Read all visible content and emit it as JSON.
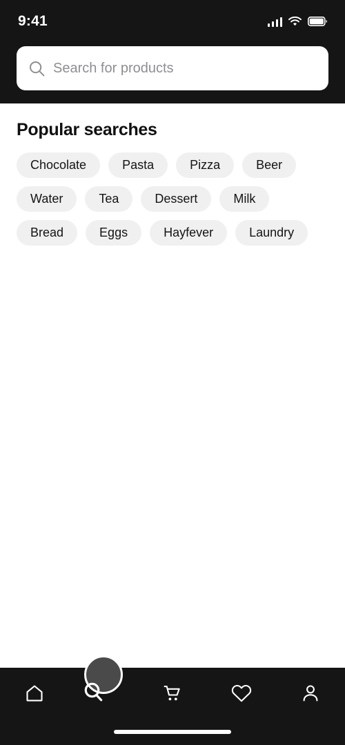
{
  "status_bar": {
    "time": "9:41",
    "icons": [
      "cellular-signal-icon",
      "wifi-icon",
      "battery-icon"
    ]
  },
  "search": {
    "placeholder": "Search for products",
    "value": "",
    "icon": "search-icon"
  },
  "main": {
    "section_title": "Popular searches",
    "chips": [
      "Chocolate",
      "Pasta",
      "Pizza",
      "Beer",
      "Water",
      "Tea",
      "Dessert",
      "Milk",
      "Bread",
      "Eggs",
      "Hayfever",
      "Laundry"
    ]
  },
  "bottom_nav": {
    "items": [
      {
        "name": "home",
        "icon": "home-icon",
        "active": false
      },
      {
        "name": "search",
        "icon": "search-icon",
        "active": true
      },
      {
        "name": "cart",
        "icon": "cart-icon",
        "active": false
      },
      {
        "name": "wishlist",
        "icon": "heart-icon",
        "active": false
      },
      {
        "name": "account",
        "icon": "person-icon",
        "active": false
      }
    ]
  },
  "colors": {
    "header_bg": "#151515",
    "page_bg": "#ffffff",
    "chip_bg": "#f0f0f0",
    "chip_text": "#141414",
    "placeholder": "#8e8e93",
    "nav_bg": "#151515",
    "nav_icon": "#ffffff",
    "active_bubble": "#4a4a4a"
  }
}
